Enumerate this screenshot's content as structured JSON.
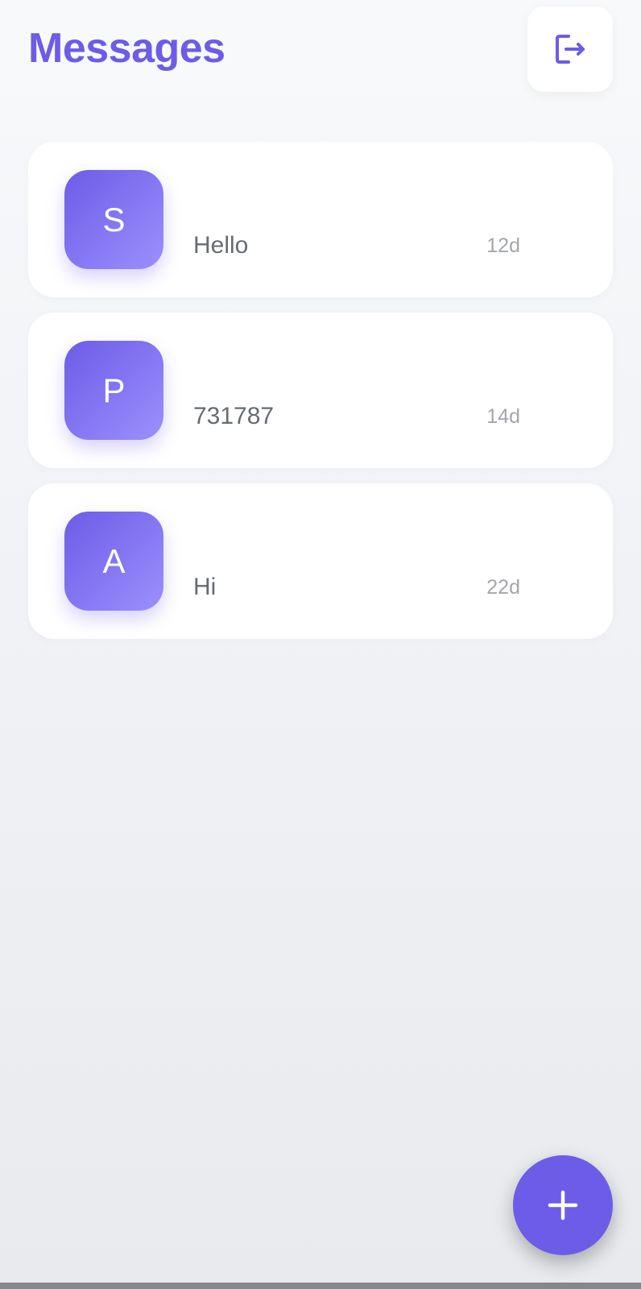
{
  "header": {
    "title": "Messages",
    "logout_icon": "logout-icon"
  },
  "conversations": [
    {
      "initial": "S",
      "name": "",
      "last_message": "Hello",
      "time": "12d"
    },
    {
      "initial": "P",
      "name": "",
      "last_message": "731787",
      "time": "14d"
    },
    {
      "initial": "A",
      "name": "",
      "last_message": "Hi",
      "time": "22d"
    }
  ],
  "fab": {
    "icon": "plus-icon"
  },
  "colors": {
    "accent": "#6c5ce7",
    "accent_light": "#9b90fd",
    "card_bg": "#ffffff",
    "preview_text": "#666b73",
    "time_text": "#a3a6ab"
  }
}
